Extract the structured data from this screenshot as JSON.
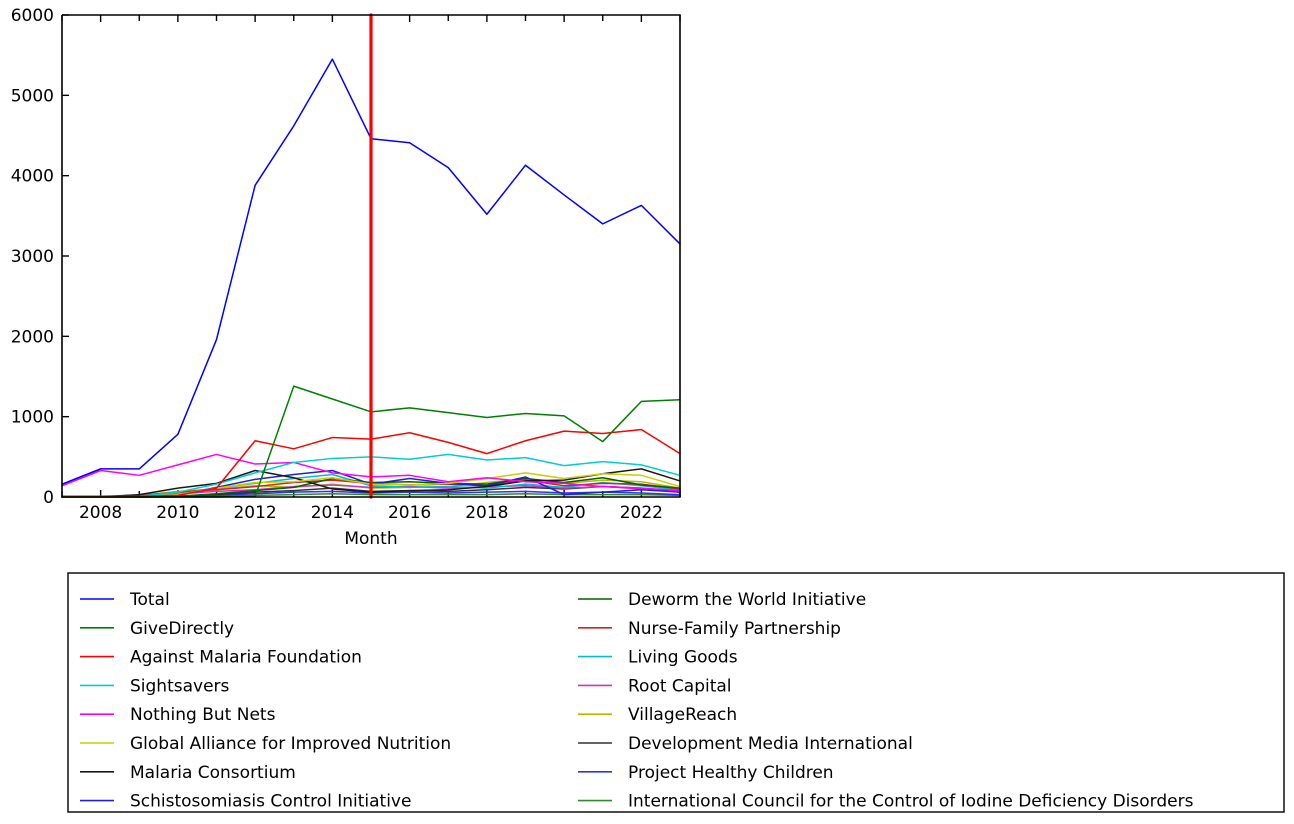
{
  "chart_data": {
    "type": "line",
    "title": "",
    "xlabel": "Month",
    "ylabel": "",
    "xlim": [
      2007,
      2023
    ],
    "ylim": [
      0,
      6000
    ],
    "grid": false,
    "legend_position": "below",
    "legend_columns": 2,
    "x_ticks": [
      2008,
      2010,
      2012,
      2014,
      2016,
      2018,
      2020,
      2022
    ],
    "y_ticks": [
      0,
      1000,
      2000,
      3000,
      4000,
      5000,
      6000
    ],
    "x_minor_ticks": [
      2007,
      2009,
      2011,
      2013,
      2015,
      2017,
      2019,
      2021,
      2023
    ],
    "x": [
      2007,
      2008,
      2009,
      2010,
      2011,
      2012,
      2013,
      2014,
      2015,
      2016,
      2017,
      2018,
      2019,
      2020,
      2021,
      2022,
      2023
    ],
    "annotations": [
      {
        "name": "reference-vline",
        "type": "vline",
        "x": 2015,
        "color": "#ff0000"
      }
    ],
    "series": [
      {
        "name": "Total",
        "color": "#0000ff",
        "values": [
          160,
          350,
          350,
          780,
          1960,
          3880,
          4620,
          5450,
          4460,
          4410,
          4100,
          3520,
          4130,
          3760,
          3400,
          3630,
          3150
        ]
      },
      {
        "name": "GiveDirectly",
        "color": "#008000",
        "values": [
          0,
          0,
          0,
          0,
          0,
          10,
          1380,
          1220,
          1060,
          1110,
          1050,
          990,
          1040,
          1010,
          690,
          1190,
          1210
        ]
      },
      {
        "name": "Against Malaria Foundation",
        "color": "#ff0000",
        "values": [
          10,
          10,
          10,
          20,
          110,
          700,
          600,
          740,
          720,
          800,
          680,
          540,
          700,
          820,
          790,
          840,
          540
        ]
      },
      {
        "name": "Sightsavers",
        "color": "#00ced1",
        "values": [
          0,
          0,
          10,
          60,
          160,
          300,
          430,
          480,
          500,
          470,
          530,
          460,
          490,
          390,
          440,
          400,
          270
        ]
      },
      {
        "name": "Nothing But Nets",
        "color": "#ff00ff",
        "values": [
          140,
          330,
          270,
          400,
          530,
          410,
          430,
          300,
          250,
          270,
          190,
          240,
          190,
          170,
          130,
          110,
          80
        ]
      },
      {
        "name": "Global Alliance for Improved Nutrition",
        "color": "#cccc00",
        "values": [
          0,
          0,
          0,
          30,
          110,
          180,
          190,
          240,
          160,
          150,
          170,
          230,
          300,
          230,
          290,
          270,
          130
        ]
      },
      {
        "name": "Malaria Consortium",
        "color": "#1a1a1a",
        "values": [
          0,
          0,
          30,
          110,
          170,
          330,
          240,
          100,
          60,
          80,
          90,
          130,
          200,
          210,
          290,
          350,
          200
        ]
      },
      {
        "name": "Schistosomiasis Control Initiative",
        "color": "#2222cc",
        "values": [
          0,
          0,
          0,
          20,
          120,
          220,
          280,
          330,
          160,
          230,
          170,
          140,
          250,
          30,
          60,
          90,
          60
        ]
      },
      {
        "name": "Deworm the World Initiative",
        "color": "#006400",
        "values": [
          0,
          0,
          0,
          10,
          40,
          80,
          120,
          230,
          180,
          190,
          170,
          160,
          230,
          180,
          240,
          150,
          110
        ]
      },
      {
        "name": "Nurse-Family Partnership",
        "color": "#d42222",
        "values": [
          0,
          10,
          20,
          60,
          90,
          130,
          180,
          210,
          170,
          150,
          160,
          140,
          210,
          140,
          170,
          160,
          100
        ]
      },
      {
        "name": "Living Goods",
        "color": "#00bcd4",
        "values": [
          0,
          0,
          10,
          50,
          110,
          170,
          230,
          280,
          140,
          120,
          130,
          110,
          160,
          120,
          180,
          140,
          90
        ]
      },
      {
        "name": "Root Capital",
        "color": "#cc33cc",
        "values": [
          0,
          0,
          10,
          40,
          70,
          90,
          130,
          150,
          120,
          130,
          110,
          130,
          140,
          110,
          130,
          100,
          70
        ]
      },
      {
        "name": "VillageReach",
        "color": "#b8b800",
        "values": [
          0,
          0,
          20,
          70,
          100,
          140,
          120,
          160,
          110,
          120,
          130,
          180,
          230,
          170,
          210,
          190,
          110
        ]
      },
      {
        "name": "Development Media International",
        "color": "#333333",
        "values": [
          0,
          0,
          0,
          10,
          30,
          60,
          80,
          110,
          70,
          80,
          70,
          90,
          120,
          100,
          130,
          110,
          60
        ]
      },
      {
        "name": "Project Healthy Children",
        "color": "#3333ee",
        "values": [
          0,
          0,
          0,
          10,
          20,
          40,
          60,
          70,
          50,
          60,
          50,
          60,
          70,
          50,
          60,
          50,
          30
        ]
      },
      {
        "name": "International Council for the Control of Iodine Deficiency Disorders",
        "color": "#2e8b2e",
        "values": [
          0,
          0,
          0,
          0,
          10,
          20,
          30,
          40,
          30,
          30,
          30,
          30,
          40,
          30,
          30,
          30,
          20
        ]
      }
    ]
  },
  "legend": {
    "columns": [
      {
        "entries": [
          {
            "label": "Total",
            "color": "#0000ff"
          },
          {
            "label": "GiveDirectly",
            "color": "#008000"
          },
          {
            "label": "Against Malaria Foundation",
            "color": "#ff0000"
          },
          {
            "label": "Sightsavers",
            "color": "#00ced1"
          },
          {
            "label": "Nothing But Nets",
            "color": "#ff00ff"
          },
          {
            "label": "Global Alliance for Improved Nutrition",
            "color": "#cccc00"
          },
          {
            "label": "Malaria Consortium",
            "color": "#1a1a1a"
          },
          {
            "label": "Schistosomiasis Control Initiative",
            "color": "#2222cc"
          }
        ]
      },
      {
        "entries": [
          {
            "label": "Deworm the World Initiative",
            "color": "#006400"
          },
          {
            "label": "Nurse-Family Partnership",
            "color": "#d42222"
          },
          {
            "label": "Living Goods",
            "color": "#00bcd4"
          },
          {
            "label": "Root Capital",
            "color": "#cc33cc"
          },
          {
            "label": "VillageReach",
            "color": "#b8b800"
          },
          {
            "label": "Development Media International",
            "color": "#333333"
          },
          {
            "label": "Project Healthy Children",
            "color": "#3333ee"
          },
          {
            "label": "International Council for the Control of Iodine Deficiency Disorders",
            "color": "#2e8b2e"
          }
        ]
      }
    ]
  }
}
